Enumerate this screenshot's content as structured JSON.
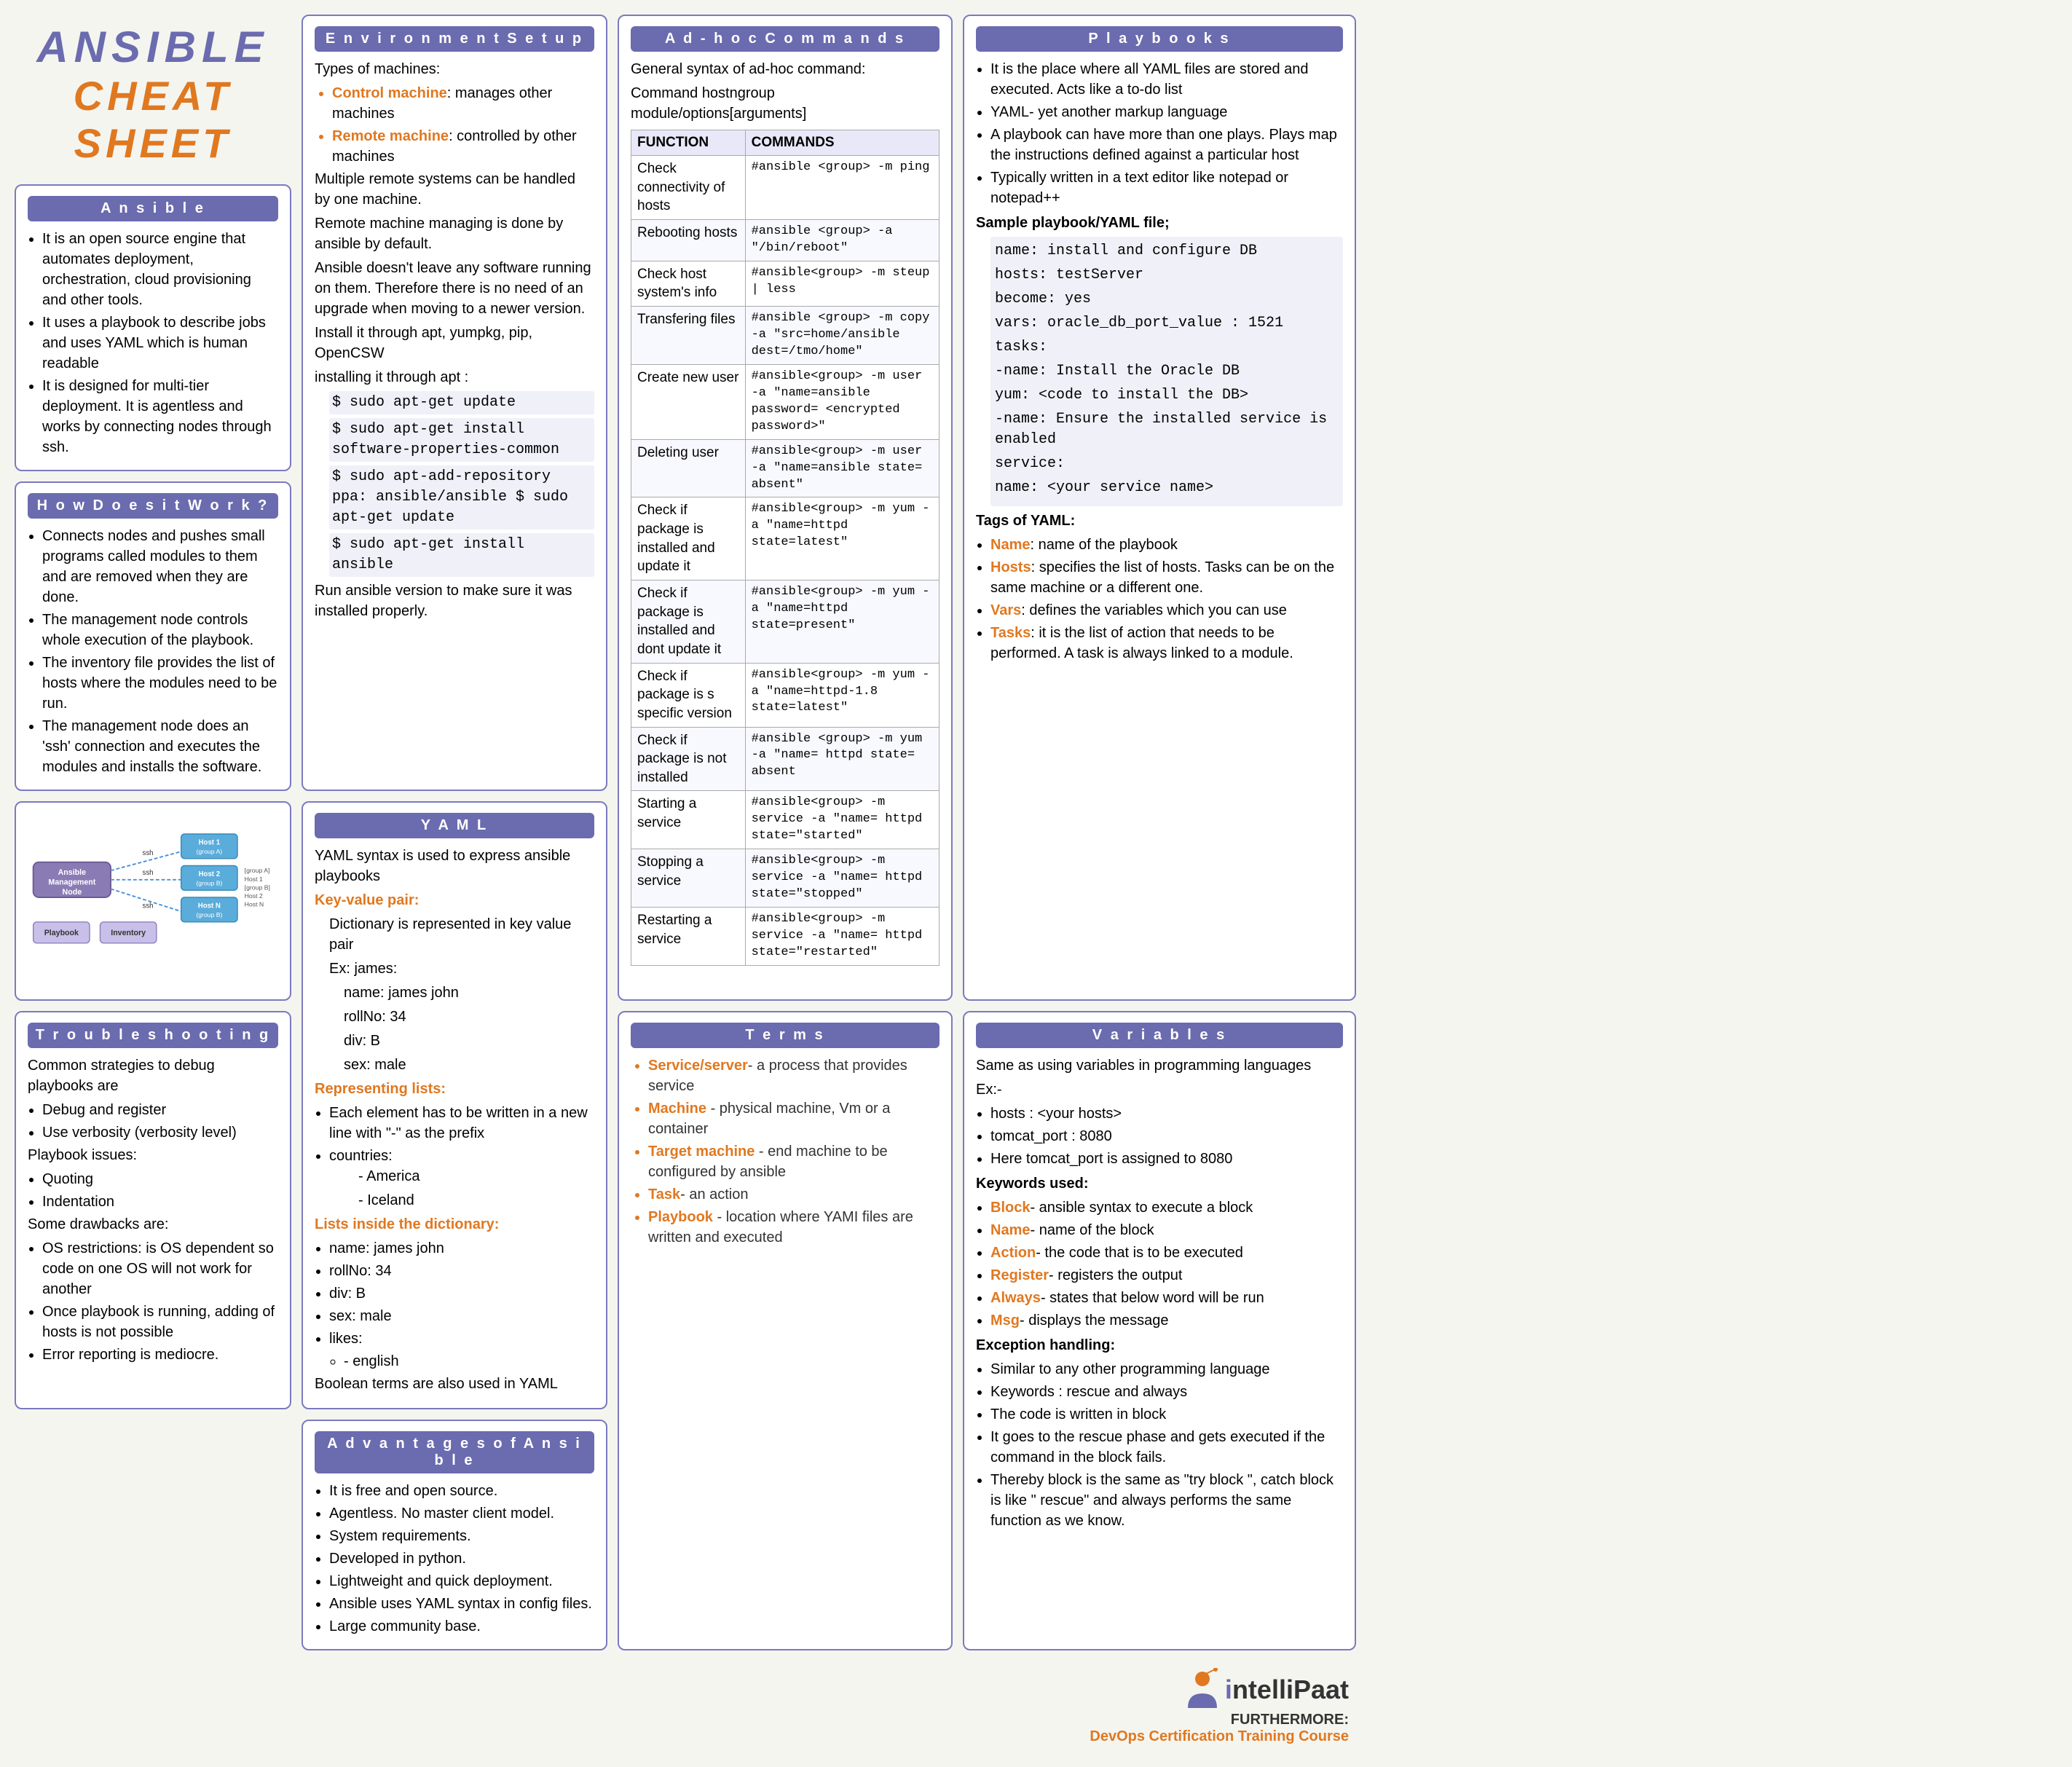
{
  "title": {
    "ansible": "ANSIBLE",
    "cheat_sheet": "CHEAT SHEET"
  },
  "ansible_section": {
    "title": "A n s i b l e",
    "points": [
      "It is an open source engine that automates deployment, orchestration, cloud provisioning and other tools.",
      "It uses a playbook to describe jobs and uses YAML which is human readable",
      "It is designed for multi-tier deployment. It is agentless and works by connecting nodes through ssh."
    ]
  },
  "how_section": {
    "title": "H o w   D o e s   i t   W o r k ?",
    "points": [
      "Connects nodes and pushes small programs called modules to them and are removed when they are done.",
      "The management node controls whole execution of the playbook.",
      "The inventory file provides the list of hosts where the modules need to be run.",
      "The management node does an 'ssh' connection and    executes the modules and installs the software."
    ]
  },
  "trouble_section": {
    "title": "T r o u b l e s h o o t i n g",
    "common": "Common strategies to debug playbooks are",
    "debug_items": [
      "Debug and register",
      "Use verbosity (verbosity level)"
    ],
    "playbook_issues": "Playbook issues:",
    "playbook_sub": [
      "Quoting",
      "Indentation"
    ],
    "drawbacks": "Some drawbacks are:",
    "drawback_items": [
      "OS restrictions: is OS dependent so code on one OS will not work for another",
      "Once playbook is running, adding of hosts is not possible",
      "Error reporting is mediocre."
    ]
  },
  "env_section": {
    "title": "E n v i r o n m e n t   S e t u p",
    "types_intro": "Types of machines:",
    "control_machine": "Control machine",
    "control_desc": ": manages other machines",
    "remote_machine": "Remote machine",
    "remote_desc": ": controlled by other machines",
    "points": [
      "Multiple remote systems can be handled by one machine.",
      "Remote machine managing is done by ansible by default.",
      "Ansible doesn't leave any software running on them. Therefore there is no need of an upgrade when moving to a newer version.",
      "Install it through apt, yumpkg, pip, OpenCSW",
      "installing it through apt :"
    ],
    "apt_commands": [
      "$ sudo apt-get update",
      "$ sudo apt-get install software-properties-common",
      "$ sudo apt-add-repository ppa: ansible/ansible $ sudo apt-get update",
      "$ sudo apt-get install ansible"
    ],
    "final": "Run ansible version to make sure it was installed properly."
  },
  "yaml_section": {
    "title": "Y A M L",
    "intro": "YAML syntax is used to express ansible playbooks",
    "key_value": "Key-value pair:",
    "kv_desc": "Dictionary is represented in key value pair",
    "kv_ex": "Ex: james:",
    "kv_items": [
      "name: james john",
      "rollNo: 34",
      "div: B",
      "sex: male"
    ],
    "rep_lists": "Representing lists:",
    "lists_desc": "Each element has to be written in a new line with \"-\" as the prefix",
    "countries": "countries:",
    "country_items": [
      "- America",
      "- Iceland"
    ],
    "lists_dict": "Lists inside the dictionary:",
    "ld_items": [
      "name: james john",
      "rollNo: 34",
      "div: B",
      "sex: male",
      "likes:"
    ],
    "likes_items": [
      "- english"
    ],
    "boolean": "Boolean terms are also used in YAML"
  },
  "adv_section": {
    "title": "A d v a n t a g e s   o f   A n s i b l e",
    "points": [
      "It is free and open source.",
      "Agentless. No master client model.",
      "System requirements.",
      "Developed in python.",
      "Lightweight and quick deployment.",
      "Ansible uses YAML syntax in config files.",
      "Large community base."
    ]
  },
  "adhoc_section": {
    "title": "A d - h o c   C o m m a n d s",
    "intro": "General syntax of ad-hoc command:",
    "syntax": "Command hostngroup module/options[arguments]",
    "col_function": "FUNCTION",
    "col_commands": "COMMANDS",
    "rows": [
      {
        "function": "Check connectivity of hosts",
        "command": "#ansible <group> -m ping"
      },
      {
        "function": "Rebooting hosts",
        "command": "#ansible <group> -a \"/bin/reboot\""
      },
      {
        "function": "Check host system's info",
        "command": "#ansible<group> -m steup | less"
      },
      {
        "function": "Transfering files",
        "command": "#ansible <group> -m copy -a \"src=home/ansible dest=/tmo/home\""
      },
      {
        "function": "Create new user",
        "command": "#ansible<group> -m user -a \"name=ansible password= <encrypted password>\""
      },
      {
        "function": "Deleting user",
        "command": "#ansible<group> -m user -a \"name=ansible state= absent\""
      },
      {
        "function": "Check if package is installed and update it",
        "command": "#ansible<group> -m yum -a \"name=httpd state=latest\""
      },
      {
        "function": "Check if package is installed and dont update it",
        "command": "#ansible<group> -m yum -a \"name=httpd state=present\""
      },
      {
        "function": "Check if package is s specific version",
        "command": "#ansible<group> -m yum -a \"name=httpd-1.8 state=latest\""
      },
      {
        "function": "Check if package is not installed",
        "command": "#ansible <group> -m yum -a \"name= httpd state= absent"
      },
      {
        "function": "Starting a service",
        "command": "#ansible<group> -m service -a \"name= httpd state=\"started\""
      },
      {
        "function": "Stopping a service",
        "command": "#ansible<group> -m service -a \"name= httpd state=\"stopped\""
      },
      {
        "function": "Restarting a service",
        "command": "#ansible<group> -m service -a \"name= httpd state=\"restarted\""
      }
    ]
  },
  "terms_section": {
    "title": "T e r m s",
    "terms": [
      {
        "label": "Service/server",
        "color": "orange",
        "desc": "- a process that provides service"
      },
      {
        "label": "Machine",
        "color": "orange",
        "desc": " - physical machine, Vm or a container"
      },
      {
        "label": "Target machine",
        "color": "orange",
        "desc": " - end machine to be configured by ansible"
      },
      {
        "label": "Task",
        "color": "orange",
        "desc": "- an action"
      },
      {
        "label": "Playbook",
        "color": "orange",
        "desc": " - location where YAMI files are written and executed"
      }
    ]
  },
  "playbooks_section": {
    "title": "P l a y b o o k s",
    "points": [
      "It is the place where all YAML files are stored and executed. Acts like a to-do list",
      "YAML- yet another markup language",
      "A playbook can have more than one plays. Plays map the instructions defined against a particular host",
      "Typically written in a text editor like notepad or notepad++"
    ],
    "sample_label": "Sample playbook/YAML file;",
    "sample_code": [
      "name: install and configure DB",
      "hosts: testServer",
      "become: yes",
      "vars: oracle_db_port_value : 1521",
      "tasks:",
      "  -name: Install the Oracle DB",
      "  yum: <code to install the DB>",
      "  -name: Ensure the installed service is enabled",
      "  service:",
      "  name: <your service name>"
    ],
    "tags_label": "Tags of YAML:",
    "tags": [
      {
        "name": "Name",
        "desc": ": name of the playbook"
      },
      {
        "name": "Hosts",
        "desc": ": specifies the list of hosts. Tasks can be on the same machine or a different one."
      },
      {
        "name": "Vars",
        "desc": ": defines the variables which you can use"
      },
      {
        "name": "Tasks",
        "desc": ": it is the list of action that needs to be performed. A task is always linked to a module."
      }
    ]
  },
  "variables_section": {
    "title": "V a r i a b l e s",
    "intro": "Same as using variables in programming languages",
    "ex_label": "Ex:-",
    "ex_items": [
      "hosts : <your hosts>",
      "tomcat_port : 8080",
      "Here tomcat_port is assigned to 8080"
    ],
    "keywords_label": "Keywords used:",
    "keywords": [
      {
        "name": "Block",
        "desc": "- ansible syntax to execute a block"
      },
      {
        "name": "Name",
        "desc": "- name of the block"
      },
      {
        "name": "Action",
        "desc": "- the code that is to be executed"
      },
      {
        "name": "Register",
        "desc": "- registers the output"
      },
      {
        "name": "Always",
        "desc": "- states that below word will be run"
      },
      {
        "name": "Msg",
        "desc": "- displays the message"
      }
    ],
    "exception_label": "Exception handling:",
    "exception_items": [
      "Similar to any other programming language",
      "Keywords : rescue and always",
      "The code is written in block",
      "It goes to the rescue phase and gets executed if the command in the block fails.",
      "Thereby block is the same as \"try block \", catch block is like \" rescue\" and always performs the same function as we know."
    ]
  },
  "logo": {
    "intelli": "i",
    "paat": "ntelliPaat",
    "furthermore": "FURTHERMORE:",
    "devops": "DevOps Certification Training Course"
  }
}
